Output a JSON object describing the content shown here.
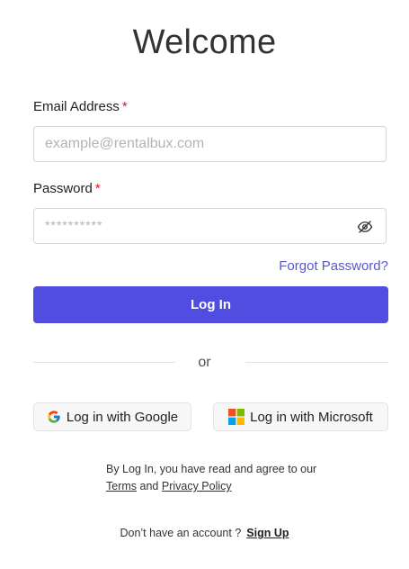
{
  "title": "Welcome",
  "email": {
    "label": "Email Address",
    "required_mark": "*",
    "placeholder": "example@rentalbux.com",
    "value": ""
  },
  "password": {
    "label": "Password",
    "required_mark": "*",
    "placeholder": "**********",
    "value": ""
  },
  "forgot_password": "Forgot Password?",
  "login_button": "Log In",
  "divider_text": "or",
  "social": {
    "google_label": "Log in with Google",
    "microsoft_label": "Log in with Microsoft"
  },
  "terms": {
    "prefix": "By Log In, you have read and agree to our",
    "terms_link": "Terms",
    "and": "and",
    "privacy_link": "Privacy Policy"
  },
  "signup": {
    "prompt": "Don’t have an account ?",
    "link": "Sign Up"
  },
  "colors": {
    "primary": "#514de0",
    "link": "#5a55d6",
    "required": "#d11a2a"
  },
  "icons": [
    "eye-off-icon",
    "google-icon",
    "microsoft-icon"
  ]
}
